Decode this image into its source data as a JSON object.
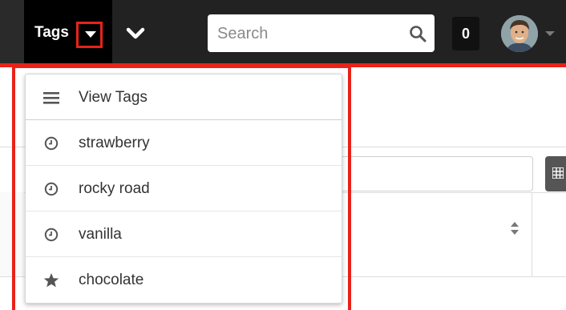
{
  "topbar": {
    "tags_label": "Tags",
    "search": {
      "placeholder": "Search"
    },
    "notification_count": "0"
  },
  "dropdown": {
    "header": {
      "label": "View Tags",
      "icon": "list-icon"
    },
    "items": [
      {
        "label": "strawberry",
        "icon": "clock-icon"
      },
      {
        "label": "rocky road",
        "icon": "clock-icon"
      },
      {
        "label": "vanilla",
        "icon": "clock-icon"
      },
      {
        "label": "chocolate",
        "icon": "star-icon"
      }
    ]
  },
  "colors": {
    "topbar": "#222222",
    "highlight": "#e8221a",
    "menu_text": "#333333",
    "icon_gray": "#555555"
  }
}
